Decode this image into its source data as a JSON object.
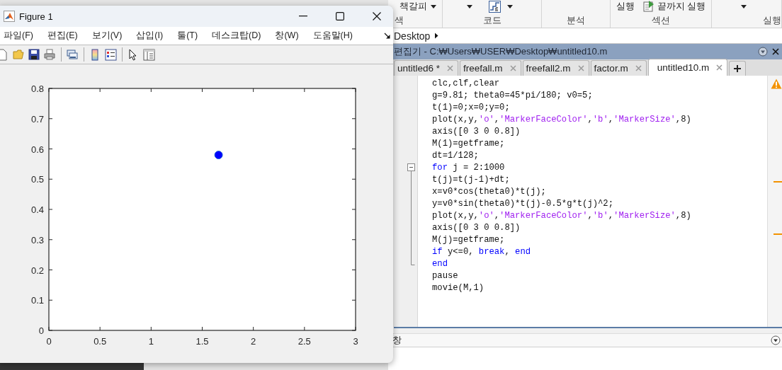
{
  "figure_window": {
    "title": "Figure 1",
    "menu": [
      "파일(F)",
      "편집(E)",
      "보기(V)",
      "삽입(I)",
      "툴(T)",
      "데스크탑(D)",
      "창(W)",
      "도움말(H)"
    ],
    "chart_data": {
      "type": "scatter",
      "xlim": [
        0,
        3
      ],
      "ylim": [
        0,
        0.8
      ],
      "xticks": [
        0,
        0.5,
        1,
        1.5,
        2,
        2.5,
        3
      ],
      "yticks": [
        0,
        0.1,
        0.2,
        0.3,
        0.4,
        0.5,
        0.6,
        0.7,
        0.8
      ],
      "x": [
        1.66
      ],
      "series": [
        {
          "color": "#0000ff",
          "values": [
            0.58
          ]
        }
      ]
    }
  },
  "toolstrip": {
    "buttons": [
      "책갈피",
      "실행",
      "끝까지 실행"
    ],
    "section_labels": [
      "색",
      "코드",
      "분석",
      "섹션",
      "실행"
    ]
  },
  "breadcrumb": {
    "path": [
      "Desktop"
    ]
  },
  "editor": {
    "title": "편집기 - C:₩Users₩USER₩Desktop₩untitled10.m",
    "tabs": [
      {
        "label": "untitled6 *",
        "selected": false
      },
      {
        "label": "freefall.m",
        "selected": false
      },
      {
        "label": "freefall2.m",
        "selected": false
      },
      {
        "label": "factor.m",
        "selected": false
      },
      {
        "label": "untitled10.m",
        "selected": true
      }
    ],
    "code": [
      [
        {
          "kind": "plain",
          "text": "clc,clf,clear"
        }
      ],
      [
        {
          "kind": "plain",
          "text": "g=9.81; theta0=45*pi/180; v0=5;"
        }
      ],
      [
        {
          "kind": "plain",
          "text": "t(1)=0;x=0;y=0;"
        }
      ],
      [
        {
          "kind": "plain",
          "text": "plot(x,y,"
        },
        {
          "kind": "string",
          "text": "'o'"
        },
        {
          "kind": "plain",
          "text": ","
        },
        {
          "kind": "string",
          "text": "'MarkerFaceColor'"
        },
        {
          "kind": "plain",
          "text": ","
        },
        {
          "kind": "string",
          "text": "'b'"
        },
        {
          "kind": "plain",
          "text": ","
        },
        {
          "kind": "string",
          "text": "'MarkerSize'"
        },
        {
          "kind": "plain",
          "text": ",8)"
        }
      ],
      [
        {
          "kind": "plain",
          "text": "axis([0 3 0 0.8])"
        }
      ],
      [
        {
          "kind": "plain",
          "text": "M(1)=getframe;"
        }
      ],
      [
        {
          "kind": "plain",
          "text": "dt=1/128;"
        }
      ],
      [
        {
          "kind": "keyword",
          "text": "for"
        },
        {
          "kind": "plain",
          "text": " j = 2:1000"
        }
      ],
      [
        {
          "kind": "plain",
          "text": "t(j)=t(j-1)+dt;"
        }
      ],
      [
        {
          "kind": "plain",
          "text": "x=v0*cos(theta0)*t(j);"
        }
      ],
      [
        {
          "kind": "plain",
          "text": "y=v0*sin(theta0)*t(j)-0.5*g*t(j)^2;"
        }
      ],
      [
        {
          "kind": "plain",
          "text": "plot(x,y,"
        },
        {
          "kind": "string",
          "text": "'o'"
        },
        {
          "kind": "plain",
          "text": ","
        },
        {
          "kind": "string",
          "text": "'MarkerFaceColor'"
        },
        {
          "kind": "plain",
          "text": ","
        },
        {
          "kind": "string",
          "text": "'b'"
        },
        {
          "kind": "plain",
          "text": ","
        },
        {
          "kind": "string",
          "text": "'MarkerSize'"
        },
        {
          "kind": "plain",
          "text": ",8)"
        }
      ],
      [
        {
          "kind": "plain",
          "text": "axis([0 3 0 0.8])"
        }
      ],
      [
        {
          "kind": "plain",
          "text": "M(j)=getframe;"
        }
      ],
      [
        {
          "kind": "keyword",
          "text": "if"
        },
        {
          "kind": "plain",
          "text": " y<=0, "
        },
        {
          "kind": "keyword",
          "text": "break"
        },
        {
          "kind": "plain",
          "text": ", "
        },
        {
          "kind": "keyword",
          "text": "end"
        }
      ],
      [
        {
          "kind": "keyword",
          "text": "end"
        }
      ],
      [
        {
          "kind": "plain",
          "text": "pause"
        }
      ],
      [
        {
          "kind": "plain",
          "text": "movie(M,1)"
        }
      ]
    ]
  },
  "command_window": {
    "title": "창"
  }
}
